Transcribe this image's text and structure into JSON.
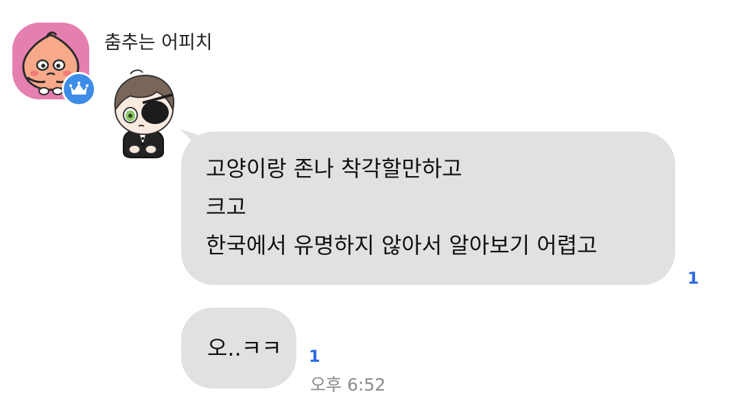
{
  "sender": {
    "name": "춤추는 어피치",
    "avatar_icon": "apeach-character-icon",
    "badge_icon": "crown-icon",
    "badge_color": "#3d8ce8",
    "avatar_bg": "#e57fb0"
  },
  "sticker": {
    "icon": "eyepatch-boy-sticker"
  },
  "messages": [
    {
      "lines": [
        "고양이랑 존나 착각할만하고",
        "크고",
        "한국에서 유명하지 않아서 알아보기 어렵고"
      ],
      "unread": "1"
    },
    {
      "text": "오..ㅋㅋ",
      "unread": "1",
      "time": "오후 6:52"
    }
  ],
  "colors": {
    "bubble": "#e1e1e1",
    "unread": "#2c6be3",
    "timestamp": "#8a8a8a"
  }
}
